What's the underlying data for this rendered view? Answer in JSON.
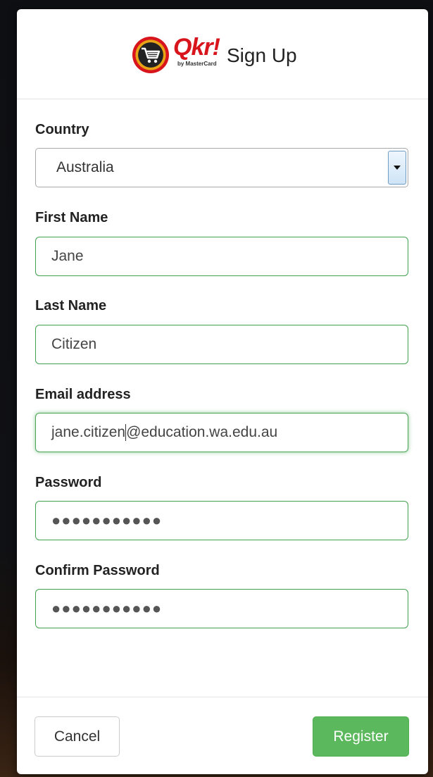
{
  "header": {
    "brand_name": "Qkr!",
    "brand_sub": "by MasterCard",
    "title": "Sign Up"
  },
  "form": {
    "country": {
      "label": "Country",
      "value": "Australia"
    },
    "first_name": {
      "label": "First Name",
      "value": "Jane"
    },
    "last_name": {
      "label": "Last Name",
      "value": "Citizen"
    },
    "email": {
      "label": "Email address",
      "value_before_cursor": "jane.citizen",
      "value_after_cursor": "@education.wa.edu.au"
    },
    "password": {
      "label": "Password",
      "masked_value": "●●●●●●●●●●●"
    },
    "confirm_password": {
      "label": "Confirm Password",
      "masked_value": "●●●●●●●●●●●"
    }
  },
  "footer": {
    "cancel_label": "Cancel",
    "register_label": "Register"
  },
  "colors": {
    "valid_border": "#3fa14c",
    "register_bg": "#5cb85c",
    "brand_red": "#d8151d"
  },
  "icons": {
    "logo": "shopping-cart-icon",
    "dropdown": "chevron-down-icon"
  }
}
